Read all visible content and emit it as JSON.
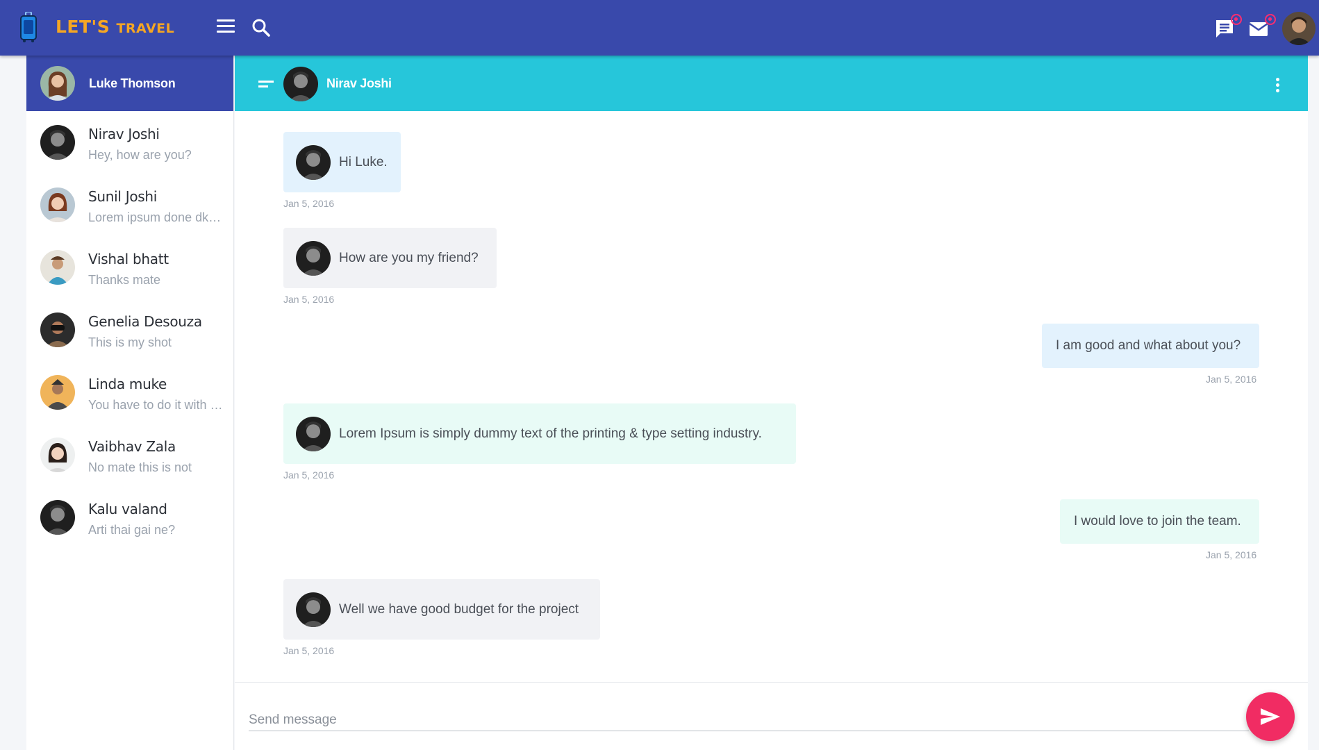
{
  "topbar": {
    "brand_main": "LET'S",
    "brand_sub": "TRAVEL",
    "icons": [
      "luggage-icon",
      "menu-icon",
      "search-icon",
      "chat-icon",
      "mail-icon"
    ]
  },
  "current_user": {
    "name": "Luke Thomson"
  },
  "contacts": [
    {
      "name": "Nirav Joshi",
      "last_message": "Hey, how are you?"
    },
    {
      "name": "Sunil Joshi",
      "last_message": "Lorem ipsum done dkaskjsdjgjkdsfdsf"
    },
    {
      "name": "Vishal bhatt",
      "last_message": "Thanks mate"
    },
    {
      "name": "Genelia Desouza",
      "last_message": "This is my shot"
    },
    {
      "name": "Linda muke",
      "last_message": "You have to do it with your hands"
    },
    {
      "name": "Vaibhav Zala",
      "last_message": "No mate this is not"
    },
    {
      "name": "Kalu valand",
      "last_message": "Arti thai gai ne?"
    }
  ],
  "chat": {
    "partner_name": "Nirav Joshi",
    "messages": [
      {
        "side": "left",
        "text": "Hi Luke.",
        "time": "Jan 5, 2016"
      },
      {
        "side": "left",
        "text": "How are you my friend?",
        "time": "Jan 5, 2016"
      },
      {
        "side": "right",
        "text": "I am good and what about you?",
        "time": "Jan 5, 2016"
      },
      {
        "side": "left",
        "text": "Lorem Ipsum is simply dummy text of the printing & type setting industry.",
        "time": "Jan 5, 2016"
      },
      {
        "side": "right",
        "text": "I would love to join the team.",
        "time": "Jan 5, 2016"
      },
      {
        "side": "left",
        "text": "Well we have good budget for the project",
        "time": "Jan 5, 2016"
      }
    ],
    "composer_placeholder": "Send message"
  },
  "colors": {
    "topbar": "#3949ab",
    "chat_header": "#26c6da",
    "send_button": "#f12c63",
    "brand": "#f5a623",
    "notification": "#ff2d6f",
    "bubble_left_blue": "#e3f2fd",
    "bubble_left_grey": "#f1f2f5",
    "bubble_left_mint": "#e8fbf6",
    "bubble_right_blue": "#e3f2fd",
    "bubble_right_mint": "#e8fbf6"
  }
}
